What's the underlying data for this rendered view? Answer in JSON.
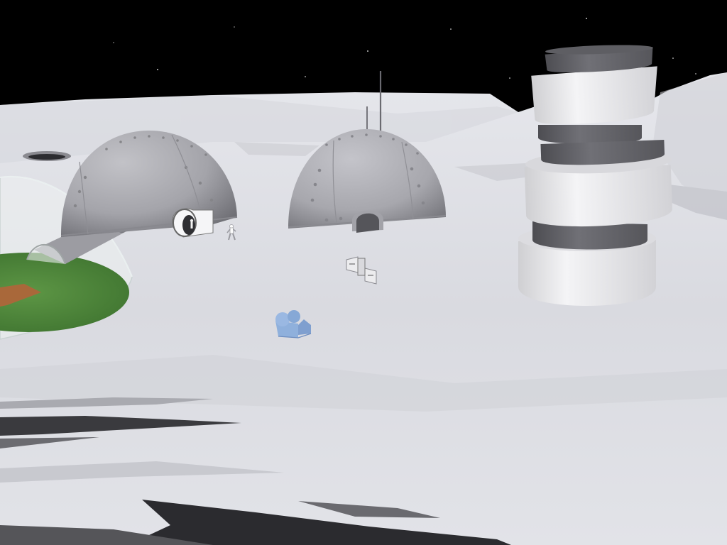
{
  "scene": {
    "kind": "3d-lunar-colony-viewport",
    "colors": {
      "sky": "#000000",
      "star": "#ffffff",
      "regolith_light": "#dcdde3",
      "regolith_mid": "#c9cad1",
      "regolith_dark": "#2a2a2e",
      "dome_metal": "#a9a9ae",
      "dome_shadow": "#6f6f75",
      "tower_white": "#eeeeee",
      "tower_dark": "#5a5a5f",
      "glass_dome": "#e9f0f0",
      "grass": "#4f8a3a",
      "soil": "#a56a3c",
      "rover_blue": "#8fb0dc"
    },
    "objects": [
      {
        "name": "greenhouse-glass-dome"
      },
      {
        "name": "habitat-dome-left"
      },
      {
        "name": "habitat-dome-center"
      },
      {
        "name": "antenna"
      },
      {
        "name": "cylindrical-tower"
      },
      {
        "name": "astronaut-figure"
      },
      {
        "name": "satellite-dish-array"
      },
      {
        "name": "rover-vehicle"
      },
      {
        "name": "crater"
      }
    ]
  }
}
